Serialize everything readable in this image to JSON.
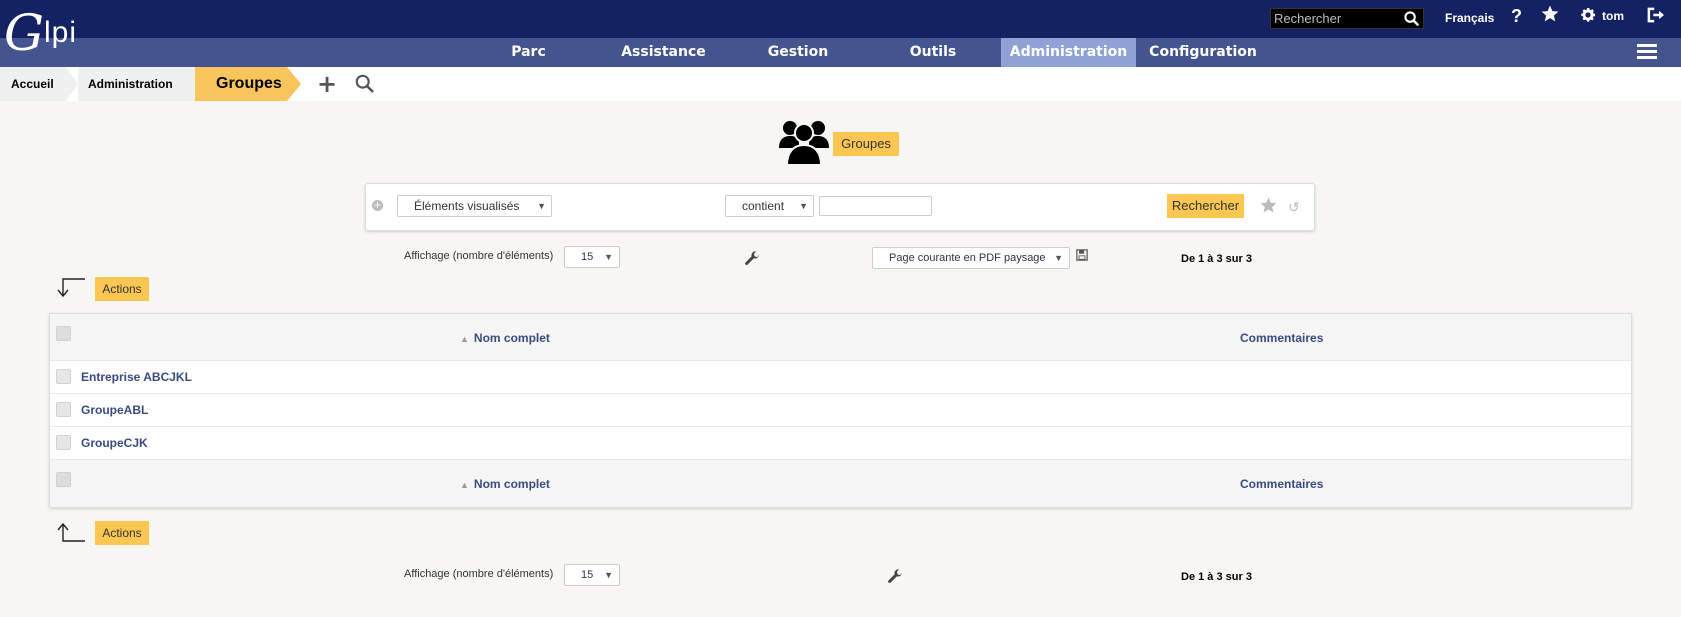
{
  "header": {
    "logo_text_g": "G",
    "logo_text_lpi": "lpi",
    "search_placeholder": "Rechercher",
    "language": "Français",
    "help": "?",
    "user": "tom"
  },
  "nav": {
    "items": [
      {
        "label": "Parc"
      },
      {
        "label": "Assistance"
      },
      {
        "label": "Gestion"
      },
      {
        "label": "Outils"
      },
      {
        "label": "Administration",
        "active": true
      },
      {
        "label": "Configuration"
      }
    ]
  },
  "breadcrumb": {
    "home": "Accueil",
    "section": "Administration",
    "current": "Groupes"
  },
  "page": {
    "title": "Groupes"
  },
  "search": {
    "add_criterion": "+",
    "field": "Éléments visualisés",
    "operator": "contient",
    "value": "",
    "button": "Rechercher"
  },
  "pager_top": {
    "label": "Affichage (nombre d'éléments)",
    "per_page": "15",
    "export": "Page courante en PDF paysage",
    "count": "De 1 à 3 sur 3"
  },
  "pager_bottom": {
    "label": "Affichage (nombre d'éléments)",
    "per_page": "15",
    "count": "De 1 à 3 sur 3"
  },
  "actions_label": "Actions",
  "table": {
    "columns": [
      "Nom complet",
      "Commentaires"
    ],
    "rows": [
      {
        "name": "Entreprise ABCJKL",
        "comment": ""
      },
      {
        "name": "GroupeABL",
        "comment": ""
      },
      {
        "name": "GroupeCJK",
        "comment": ""
      }
    ]
  },
  "colors": {
    "topbar": "#142264",
    "navbar": "#44548f",
    "nav_active": "#8ea2d6",
    "accent": "#fbc752",
    "link": "#3a4b80"
  },
  "icons": [
    "search-icon",
    "help-icon",
    "star-icon",
    "gear-icon",
    "logout-icon",
    "menu-icon",
    "add-icon",
    "groups-icon",
    "wrench-icon",
    "save-icon",
    "reset-icon",
    "actions-arrow-icon"
  ]
}
